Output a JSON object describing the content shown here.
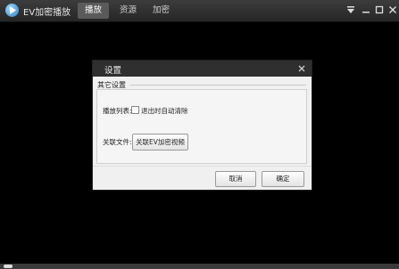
{
  "app": {
    "title": "EV加密播放"
  },
  "tabs": [
    {
      "label": "播放",
      "active": true
    },
    {
      "label": "资源",
      "active": false
    },
    {
      "label": "加密",
      "active": false
    }
  ],
  "window_controls": [
    "menu-icon",
    "minimize-icon",
    "maximize-icon",
    "close-icon"
  ],
  "dialog": {
    "title": "设置",
    "group_title": "其它设置",
    "playlist_label": "播放列表:",
    "auto_clear_label": "退出时自动清除",
    "auto_clear_checked": false,
    "associate_label": "关联文件:",
    "associate_button": "关联EV加密视频",
    "cancel_button": "取消",
    "ok_button": "确定"
  },
  "colors": {
    "titlebar": "#2f2f2f",
    "dialog_bg": "#f0f0f0",
    "active_tab": "#5a5a5a"
  }
}
